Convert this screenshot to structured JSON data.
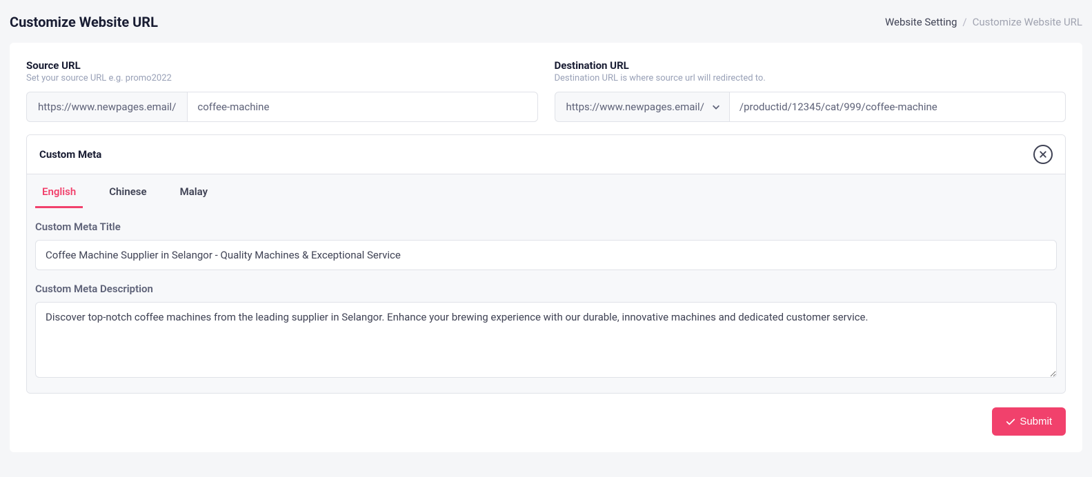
{
  "header": {
    "title": "Customize Website URL",
    "breadcrumb": {
      "parent": "Website Setting",
      "current": "Customize Website URL"
    }
  },
  "source": {
    "label": "Source URL",
    "helper": "Set your source URL e.g. promo2022",
    "prefix": "https://www.newpages.email/",
    "value": "coffee-machine"
  },
  "destination": {
    "label": "Destination URL",
    "helper": "Destination URL is where source url will redirected to.",
    "prefix": "https://www.newpages.email/",
    "value": "/productid/12345/cat/999/coffee-machine"
  },
  "meta": {
    "panel_title": "Custom Meta",
    "tabs": {
      "english": "English",
      "chinese": "Chinese",
      "malay": "Malay"
    },
    "title_label": "Custom Meta Title",
    "title_value": "Coffee Machine Supplier in Selangor - Quality Machines & Exceptional Service",
    "description_label": "Custom Meta Description",
    "description_value": "Discover top-notch coffee machines from the leading supplier in Selangor. Enhance your brewing experience with our durable, innovative machines and dedicated customer service."
  },
  "actions": {
    "submit": "Submit"
  }
}
